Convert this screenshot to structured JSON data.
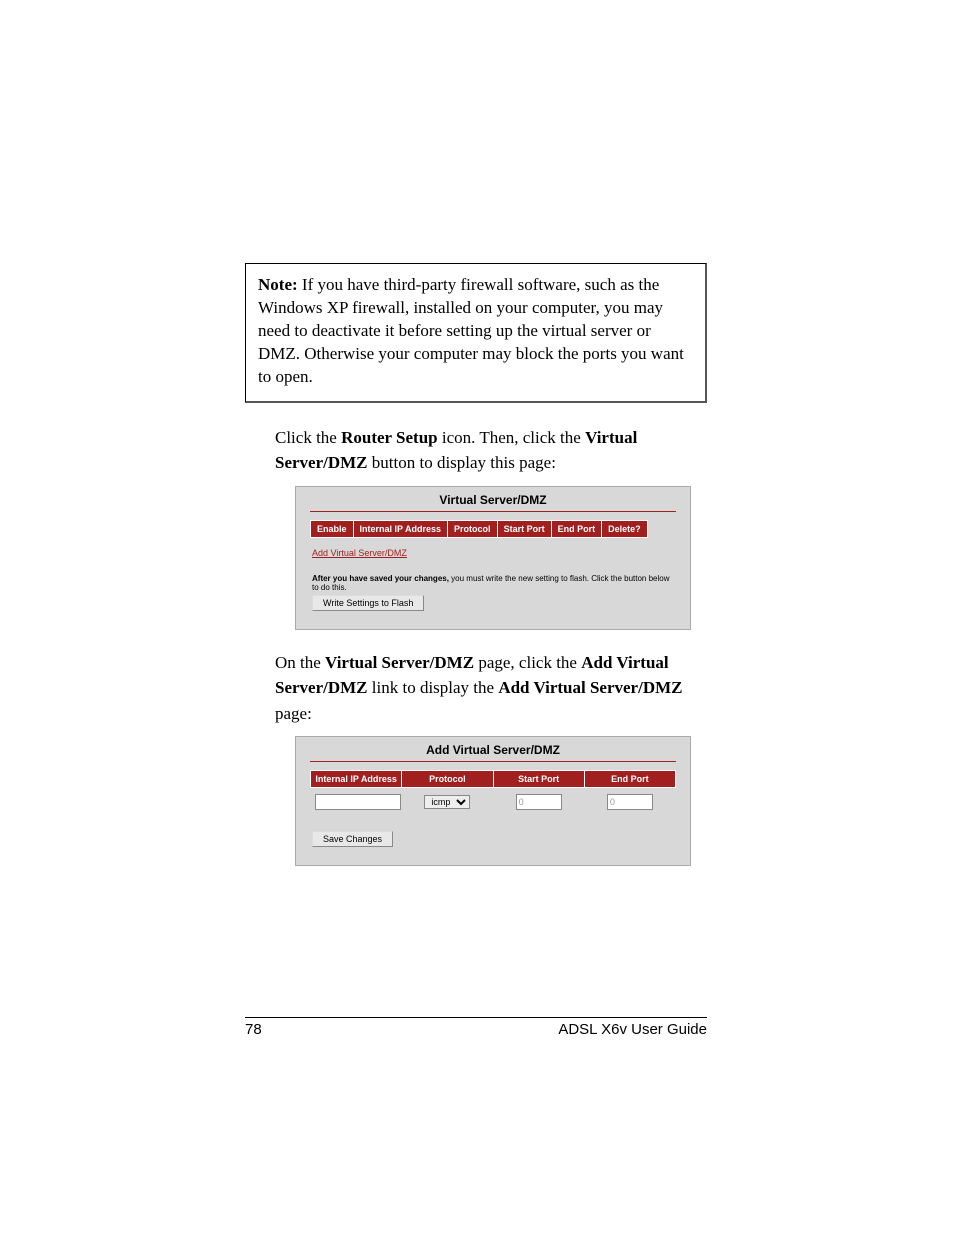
{
  "note": {
    "label": "Note:",
    "text": " If you have third-party firewall software, such as the Windows XP firewall, installed on your computer, you may need to deactivate it before setting up the virtual server or DMZ. Otherwise your computer may block the ports you want to open."
  },
  "para1": {
    "t1": "Click the ",
    "b1": "Router Setup",
    "t2": " icon. Then, click the ",
    "b2": "Virtual Server/DMZ",
    "t3": " button to display this page:"
  },
  "panel1": {
    "title": "Virtual Server/DMZ",
    "headers": [
      "Enable",
      "Internal IP Address",
      "Protocol",
      "Start Port",
      "End Port",
      "Delete?"
    ],
    "link": "Add Virtual Server/DMZ",
    "flash_bold": "After you have saved your changes,",
    "flash_rest": " you must write the new setting to flash. Click the button below to do this.",
    "button": "Write Settings to Flash"
  },
  "para2": {
    "t1": "On the ",
    "b1": "Virtual Server/DMZ",
    "t2": " page, click the ",
    "b2": "Add Virtual Server/DMZ",
    "t3": " link to display the ",
    "b3": "Add Virtual Server/DMZ",
    "t4": " page:"
  },
  "panel2": {
    "title": "Add Virtual Server/DMZ",
    "headers": [
      "Internal IP Address",
      "Protocol",
      "Start Port",
      "End Port"
    ],
    "ip_value": "",
    "protocol_value": "icmp",
    "start_port": "0",
    "end_port": "0",
    "button": "Save Changes"
  },
  "footer": {
    "page": "78",
    "guide": "ADSL X6v User Guide"
  }
}
